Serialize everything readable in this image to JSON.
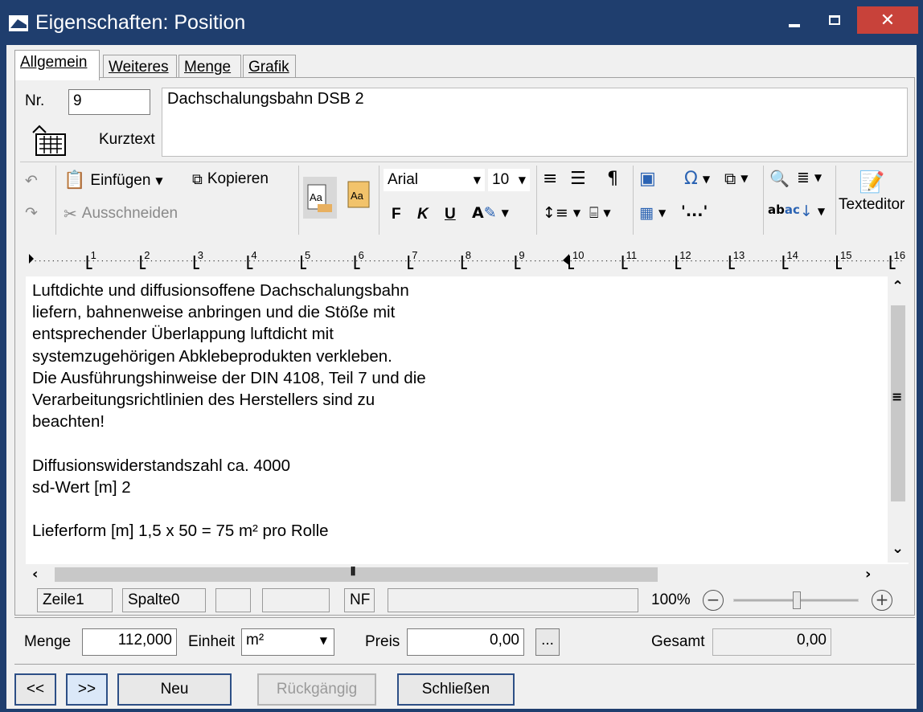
{
  "window": {
    "title": "Eigenschaften: Position",
    "minimize": "_",
    "maximize": "□",
    "close": "✕"
  },
  "tabs": [
    {
      "label": "Allgemein",
      "active": true
    },
    {
      "label": "Weiteres",
      "active": false
    },
    {
      "label": "Menge",
      "active": false
    },
    {
      "label": "Grafik",
      "active": false
    }
  ],
  "header": {
    "nr_label": "Nr.",
    "nr_value": "9",
    "kurztext_label": "Kurztext",
    "kurztext_value": "Dachschalungsbahn DSB 2"
  },
  "toolbar": {
    "insert": "Einfügen",
    "copy": "Kopieren",
    "cut": "Ausschneiden",
    "font": "Arial",
    "size": "10",
    "bold": "F",
    "italic": "K",
    "underline": "U",
    "texteditor": "Texteditor"
  },
  "ruler": {
    "numbers": [
      "1",
      "2",
      "3",
      "4",
      "5",
      "6",
      "7",
      "8",
      "9",
      "10",
      "11",
      "12",
      "13",
      "14",
      "15",
      "16"
    ]
  },
  "editor": {
    "text": "Luftdichte und diffusionsoffene Dachschalungsbahn\nliefern, bahnenweise anbringen und die Stöße mit\nentsprechender Überlappung luftdicht mit\nsystemzugehörigen Abklebeprodukten verkleben.\nDie Ausführungshinweise der DIN 4108, Teil 7 und die\nVerarbeitungsrichtlinien des Herstellers sind zu\nbeachten!\n\nDiffusionswiderstandszahl ca. 4000\nsd-Wert [m] 2\n\nLieferform [m] 1,5 x 50 = 75 m² pro Rolle"
  },
  "status": {
    "line": "Zeile1",
    "column": "Spalte0",
    "nf": "NF",
    "zoom": "100%",
    "zoom_level_fraction": 0.5
  },
  "quantity": {
    "menge_label": "Menge",
    "menge_value": "112,000",
    "einheit_label": "Einheit",
    "einheit_value": "m²",
    "preis_label": "Preis",
    "preis_value": "0,00",
    "ellipsis": "...",
    "gesamt_label": "Gesamt",
    "gesamt_value": "0,00"
  },
  "buttons": {
    "prev": "<<",
    "next": ">>",
    "new": "Neu",
    "undo": "Rückgängig",
    "close": "Schließen"
  },
  "colors": {
    "titlebar": "#1f3e6e",
    "close_button": "#c8423a",
    "accent_blue": "#2b63b3"
  }
}
